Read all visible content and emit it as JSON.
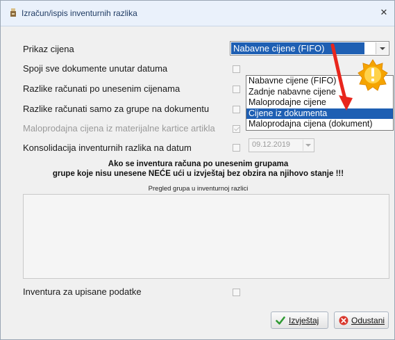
{
  "window": {
    "title": "Izračun/ispis inventurnih razlika",
    "close_glyph": "✕"
  },
  "form": {
    "prikaz_cijena_label": "Prikaz cijena",
    "prikaz_cijena_value": "Nabavne cijene (FIFO)",
    "options": [
      "Nabavne cijene (FIFO)",
      "Zadnje nabavne cijene",
      "Maloprodajne cijene",
      "Cijene iz dokumenta",
      "Maloprodajna cijena (dokument)"
    ],
    "highlighted_option": "Cijene iz dokumenta",
    "spoji_label": "Spoji sve dokumente unutar datuma",
    "razlike_unesenim_label": "Razlike računati po unesenim cijenama",
    "razlike_grupe_label": "Razlike računati samo za grupe na dokumentu",
    "maloprodajna_kartica_label": "Maloprodajna cijena iz materijalne kartice artikla",
    "konsolidacija_label": "Konsolidacija inventurnih razlika na datum",
    "konsolidacija_date": "09.12.2019",
    "note_line1": "Ako se inventura računa po unesenim grupama",
    "note_line2": "grupe koje nisu unesene NEĆE ući u izvještaj bez obzira na njihovo stanje !!!",
    "pregled_caption": "Pregled grupa u inventurnoj razlici",
    "inventura_label": "Inventura za upisane podatke"
  },
  "buttons": {
    "izvjestaj": "Izvještaj",
    "odustani": "Odustani"
  },
  "colors": {
    "selection": "#1e5fb3",
    "annotation_arrow": "#e8261d",
    "warning_badge": "#f5a400"
  }
}
